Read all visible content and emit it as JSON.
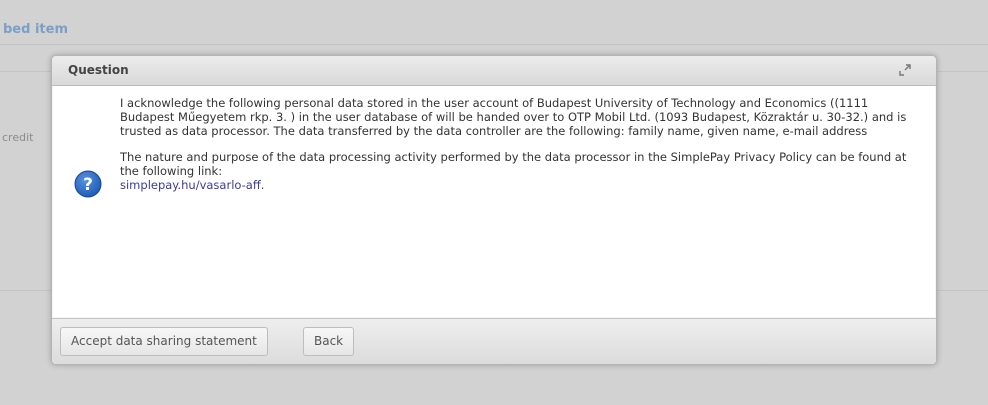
{
  "background": {
    "title": "bed item",
    "side_text": "credit"
  },
  "dialog": {
    "title": "Question",
    "paragraph1": "I acknowledge the following personal data stored in the user account of Budapest University of Technology and Economics ((1111 Budapest Műegyetem rkp. 3. ) in the user database of will be handed over to OTP Mobil Ltd. (1093 Budapest, Közraktár u. 30-32.) and is trusted as data processor. The data transferred by the data controller are the following: family name, given name, e-mail address",
    "paragraph2": "The nature and purpose of the data processing activity performed by the data processor in the SimplePay Privacy Policy can be found at the following link:",
    "link": "simplepay.hu/vasarlo-aff.",
    "buttons": {
      "accept": "Accept data sharing statement",
      "back": "Back"
    }
  },
  "colors": {
    "accent_link": "#3a3aa0",
    "question_icon": "#1f5db8"
  },
  "icons": [
    "maximize-icon",
    "question-icon"
  ]
}
